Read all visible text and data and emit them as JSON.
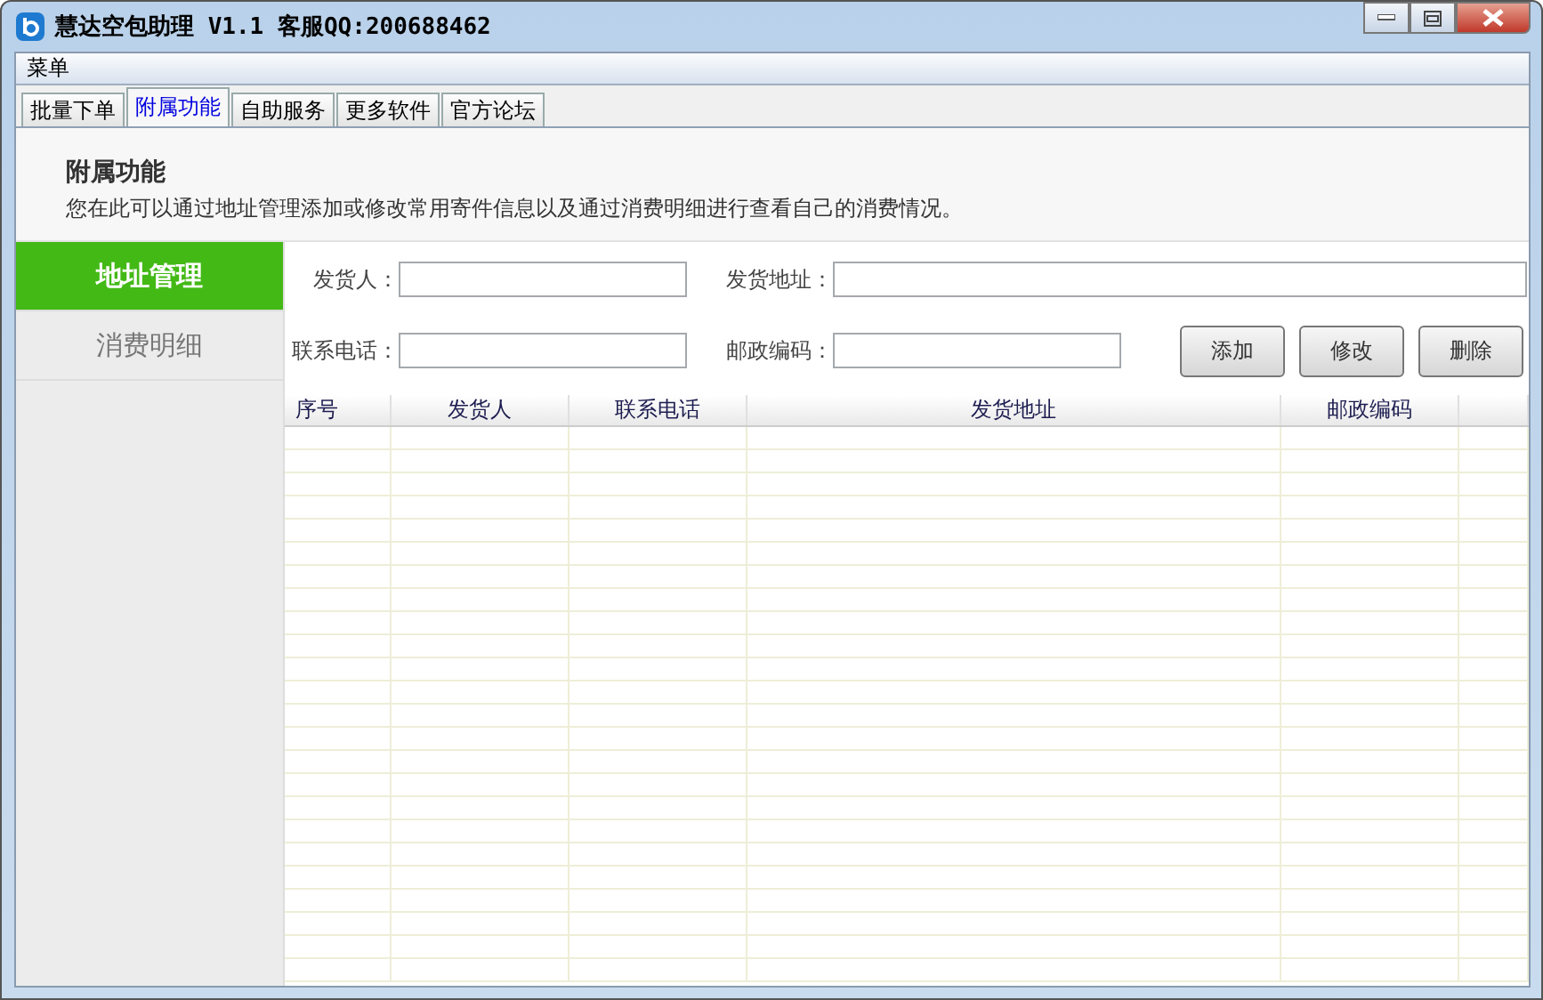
{
  "window": {
    "title": "慧达空包助理 V1.1 客服QQ:200688462"
  },
  "menu": [
    "菜单"
  ],
  "tabs": [
    {
      "label": "批量下单",
      "selected": false
    },
    {
      "label": "附属功能",
      "selected": true
    },
    {
      "label": "自助服务",
      "selected": false
    },
    {
      "label": "更多软件",
      "selected": false
    },
    {
      "label": "官方论坛",
      "selected": false
    }
  ],
  "header": {
    "title": "附属功能",
    "description": "您在此可以通过地址管理添加或修改常用寄件信息以及通过消费明细进行查看自己的消费情况。"
  },
  "sidebar": {
    "items": [
      {
        "label": "地址管理",
        "selected": true
      },
      {
        "label": "消费明细",
        "selected": false
      }
    ]
  },
  "form": {
    "row1": [
      {
        "label": "发货人：",
        "wide": false
      },
      {
        "label": "发货地址：",
        "wide": true
      }
    ],
    "row2": [
      {
        "label": "联系电话：",
        "wide": false
      },
      {
        "label": "邮政编码：",
        "wide": false
      }
    ],
    "buttons": [
      "添加",
      "修改",
      "删除"
    ]
  },
  "table": {
    "columns": [
      "序号",
      "发货人",
      "联系电话",
      "发货地址",
      "邮政编码"
    ]
  }
}
